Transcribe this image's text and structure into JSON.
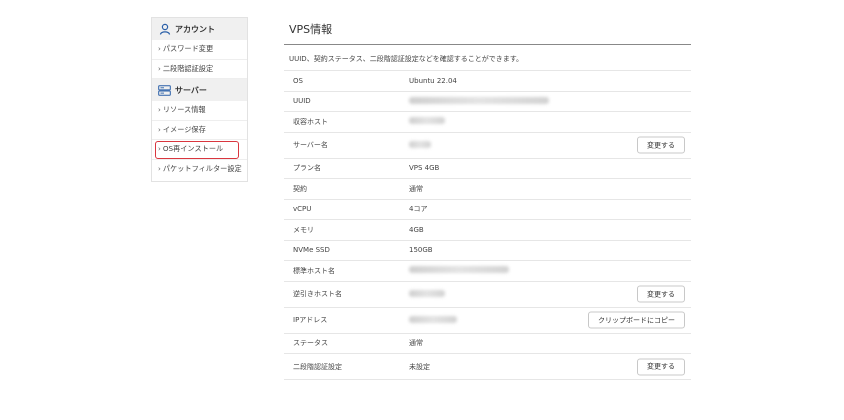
{
  "sidebar": {
    "account": {
      "title": "アカウント",
      "icon": "user-icon",
      "items": [
        {
          "label": "パスワード変更"
        },
        {
          "label": "二段階認証設定"
        }
      ]
    },
    "server": {
      "title": "サーバー",
      "icon": "server-icon",
      "items": [
        {
          "label": "リソース情報"
        },
        {
          "label": "イメージ保存"
        },
        {
          "label": "OS再インストール"
        },
        {
          "label": "パケットフィルター設定"
        }
      ]
    },
    "highlight_color": "#d9363e"
  },
  "main": {
    "title": "VPS情報",
    "description": "UUID、契約ステータス、二段階認証設定などを確認することができます。",
    "rows": [
      {
        "label": "OS",
        "value": "Ubuntu 22.04"
      },
      {
        "label": "UUID",
        "value": ""
      },
      {
        "label": "収容ホスト",
        "value": ""
      },
      {
        "label": "サーバー名",
        "value": "",
        "button": "変更する"
      },
      {
        "label": "プラン名",
        "value": "VPS 4GB"
      },
      {
        "label": "契約",
        "value": "通常"
      },
      {
        "label": "vCPU",
        "value": "4コア"
      },
      {
        "label": "メモリ",
        "value": "4GB"
      },
      {
        "label": "NVMe SSD",
        "value": "150GB"
      },
      {
        "label": "標準ホスト名",
        "value": ""
      },
      {
        "label": "逆引きホスト名",
        "value": "",
        "button": "変更する"
      },
      {
        "label": "IPアドレス",
        "value": "",
        "button": "クリップボードにコピー"
      },
      {
        "label": "ステータス",
        "value": "通常"
      },
      {
        "label": "二段階認証設定",
        "value": "未設定",
        "button": "変更する"
      }
    ]
  }
}
